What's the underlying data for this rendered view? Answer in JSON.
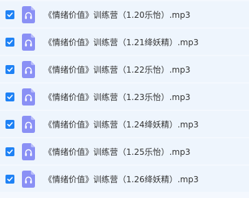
{
  "file_list": {
    "accent_color": "#1f82f5",
    "file_icon_color": "#8a90f5",
    "items": [
      {
        "name": "《情绪价值》训练营（1.20乐怡）.mp3",
        "checked": true,
        "icon": "audio-file-icon"
      },
      {
        "name": "《情绪价值》训练营（1.21绛妖精）.mp3",
        "checked": true,
        "icon": "audio-file-icon"
      },
      {
        "name": "《情绪价值》训练营（1.22乐怡）.mp3",
        "checked": true,
        "icon": "audio-file-icon"
      },
      {
        "name": "《情绪价值》训练营（1.23乐怡）.mp3",
        "checked": true,
        "icon": "audio-file-icon"
      },
      {
        "name": "《情绪价值》训练营（1.24绛妖精）.mp3",
        "checked": true,
        "icon": "audio-file-icon"
      },
      {
        "name": "《情绪价值》训练营（1.25乐怡）.mp3",
        "checked": true,
        "icon": "audio-file-icon"
      },
      {
        "name": "《情绪价值》训练营（1.26绛妖精）.mp3",
        "checked": true,
        "icon": "audio-file-icon"
      }
    ]
  }
}
